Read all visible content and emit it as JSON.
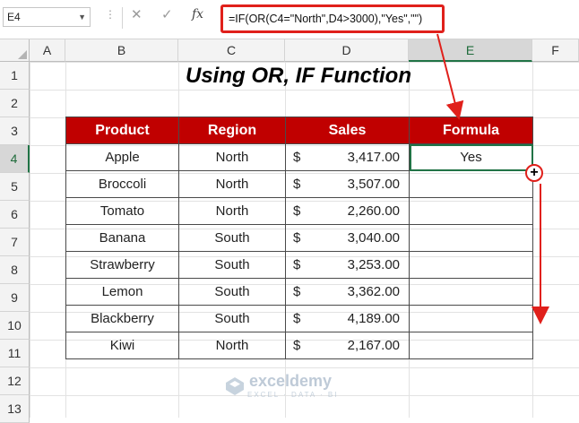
{
  "formula_bar": {
    "name_box": "E4",
    "dots": "⋮",
    "cancel_icon": "✕",
    "enter_icon": "✓",
    "fx_label": "fx",
    "formula": "=IF(OR(C4=\"North\",D4>3000),\"Yes\",\"\")"
  },
  "columns": [
    "A",
    "B",
    "C",
    "D",
    "E",
    "F"
  ],
  "rows": [
    "1",
    "2",
    "3",
    "4",
    "5",
    "6",
    "7",
    "8",
    "9",
    "10",
    "11",
    "12",
    "13"
  ],
  "title": "Using OR, IF Function",
  "table": {
    "headers": [
      "Product",
      "Region",
      "Sales",
      "Formula"
    ],
    "rows": [
      {
        "product": "Apple",
        "region": "North",
        "currency": "$",
        "sales": "3,417.00",
        "formula": "Yes"
      },
      {
        "product": "Broccoli",
        "region": "North",
        "currency": "$",
        "sales": "3,507.00",
        "formula": ""
      },
      {
        "product": "Tomato",
        "region": "North",
        "currency": "$",
        "sales": "2,260.00",
        "formula": ""
      },
      {
        "product": "Banana",
        "region": "South",
        "currency": "$",
        "sales": "3,040.00",
        "formula": ""
      },
      {
        "product": "Strawberry",
        "region": "South",
        "currency": "$",
        "sales": "3,253.00",
        "formula": ""
      },
      {
        "product": "Lemon",
        "region": "South",
        "currency": "$",
        "sales": "3,362.00",
        "formula": ""
      },
      {
        "product": "Blackberry",
        "region": "South",
        "currency": "$",
        "sales": "4,189.00",
        "formula": ""
      },
      {
        "product": "Kiwi",
        "region": "North",
        "currency": "$",
        "sales": "2,167.00",
        "formula": ""
      }
    ]
  },
  "watermark": {
    "name": "exceldemy",
    "tagline": "EXCEL · DATA · BI"
  },
  "colors": {
    "header_fill": "#c00000",
    "accent_red": "#e0201b",
    "selection_green": "#217346"
  }
}
